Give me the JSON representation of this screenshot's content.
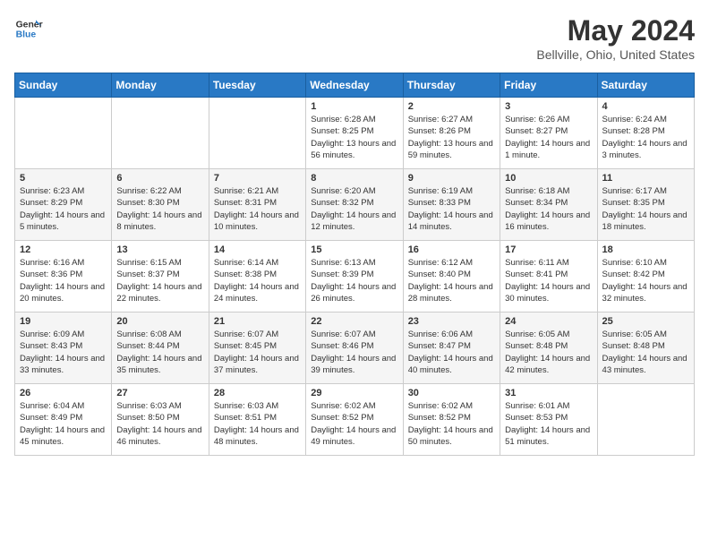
{
  "header": {
    "logo_line1": "General",
    "logo_line2": "Blue",
    "month": "May 2024",
    "location": "Bellville, Ohio, United States"
  },
  "weekdays": [
    "Sunday",
    "Monday",
    "Tuesday",
    "Wednesday",
    "Thursday",
    "Friday",
    "Saturday"
  ],
  "weeks": [
    [
      {
        "day": "",
        "info": ""
      },
      {
        "day": "",
        "info": ""
      },
      {
        "day": "",
        "info": ""
      },
      {
        "day": "1",
        "info": "Sunrise: 6:28 AM\nSunset: 8:25 PM\nDaylight: 13 hours and 56 minutes."
      },
      {
        "day": "2",
        "info": "Sunrise: 6:27 AM\nSunset: 8:26 PM\nDaylight: 13 hours and 59 minutes."
      },
      {
        "day": "3",
        "info": "Sunrise: 6:26 AM\nSunset: 8:27 PM\nDaylight: 14 hours and 1 minute."
      },
      {
        "day": "4",
        "info": "Sunrise: 6:24 AM\nSunset: 8:28 PM\nDaylight: 14 hours and 3 minutes."
      }
    ],
    [
      {
        "day": "5",
        "info": "Sunrise: 6:23 AM\nSunset: 8:29 PM\nDaylight: 14 hours and 5 minutes."
      },
      {
        "day": "6",
        "info": "Sunrise: 6:22 AM\nSunset: 8:30 PM\nDaylight: 14 hours and 8 minutes."
      },
      {
        "day": "7",
        "info": "Sunrise: 6:21 AM\nSunset: 8:31 PM\nDaylight: 14 hours and 10 minutes."
      },
      {
        "day": "8",
        "info": "Sunrise: 6:20 AM\nSunset: 8:32 PM\nDaylight: 14 hours and 12 minutes."
      },
      {
        "day": "9",
        "info": "Sunrise: 6:19 AM\nSunset: 8:33 PM\nDaylight: 14 hours and 14 minutes."
      },
      {
        "day": "10",
        "info": "Sunrise: 6:18 AM\nSunset: 8:34 PM\nDaylight: 14 hours and 16 minutes."
      },
      {
        "day": "11",
        "info": "Sunrise: 6:17 AM\nSunset: 8:35 PM\nDaylight: 14 hours and 18 minutes."
      }
    ],
    [
      {
        "day": "12",
        "info": "Sunrise: 6:16 AM\nSunset: 8:36 PM\nDaylight: 14 hours and 20 minutes."
      },
      {
        "day": "13",
        "info": "Sunrise: 6:15 AM\nSunset: 8:37 PM\nDaylight: 14 hours and 22 minutes."
      },
      {
        "day": "14",
        "info": "Sunrise: 6:14 AM\nSunset: 8:38 PM\nDaylight: 14 hours and 24 minutes."
      },
      {
        "day": "15",
        "info": "Sunrise: 6:13 AM\nSunset: 8:39 PM\nDaylight: 14 hours and 26 minutes."
      },
      {
        "day": "16",
        "info": "Sunrise: 6:12 AM\nSunset: 8:40 PM\nDaylight: 14 hours and 28 minutes."
      },
      {
        "day": "17",
        "info": "Sunrise: 6:11 AM\nSunset: 8:41 PM\nDaylight: 14 hours and 30 minutes."
      },
      {
        "day": "18",
        "info": "Sunrise: 6:10 AM\nSunset: 8:42 PM\nDaylight: 14 hours and 32 minutes."
      }
    ],
    [
      {
        "day": "19",
        "info": "Sunrise: 6:09 AM\nSunset: 8:43 PM\nDaylight: 14 hours and 33 minutes."
      },
      {
        "day": "20",
        "info": "Sunrise: 6:08 AM\nSunset: 8:44 PM\nDaylight: 14 hours and 35 minutes."
      },
      {
        "day": "21",
        "info": "Sunrise: 6:07 AM\nSunset: 8:45 PM\nDaylight: 14 hours and 37 minutes."
      },
      {
        "day": "22",
        "info": "Sunrise: 6:07 AM\nSunset: 8:46 PM\nDaylight: 14 hours and 39 minutes."
      },
      {
        "day": "23",
        "info": "Sunrise: 6:06 AM\nSunset: 8:47 PM\nDaylight: 14 hours and 40 minutes."
      },
      {
        "day": "24",
        "info": "Sunrise: 6:05 AM\nSunset: 8:48 PM\nDaylight: 14 hours and 42 minutes."
      },
      {
        "day": "25",
        "info": "Sunrise: 6:05 AM\nSunset: 8:48 PM\nDaylight: 14 hours and 43 minutes."
      }
    ],
    [
      {
        "day": "26",
        "info": "Sunrise: 6:04 AM\nSunset: 8:49 PM\nDaylight: 14 hours and 45 minutes."
      },
      {
        "day": "27",
        "info": "Sunrise: 6:03 AM\nSunset: 8:50 PM\nDaylight: 14 hours and 46 minutes."
      },
      {
        "day": "28",
        "info": "Sunrise: 6:03 AM\nSunset: 8:51 PM\nDaylight: 14 hours and 48 minutes."
      },
      {
        "day": "29",
        "info": "Sunrise: 6:02 AM\nSunset: 8:52 PM\nDaylight: 14 hours and 49 minutes."
      },
      {
        "day": "30",
        "info": "Sunrise: 6:02 AM\nSunset: 8:52 PM\nDaylight: 14 hours and 50 minutes."
      },
      {
        "day": "31",
        "info": "Sunrise: 6:01 AM\nSunset: 8:53 PM\nDaylight: 14 hours and 51 minutes."
      },
      {
        "day": "",
        "info": ""
      }
    ]
  ]
}
